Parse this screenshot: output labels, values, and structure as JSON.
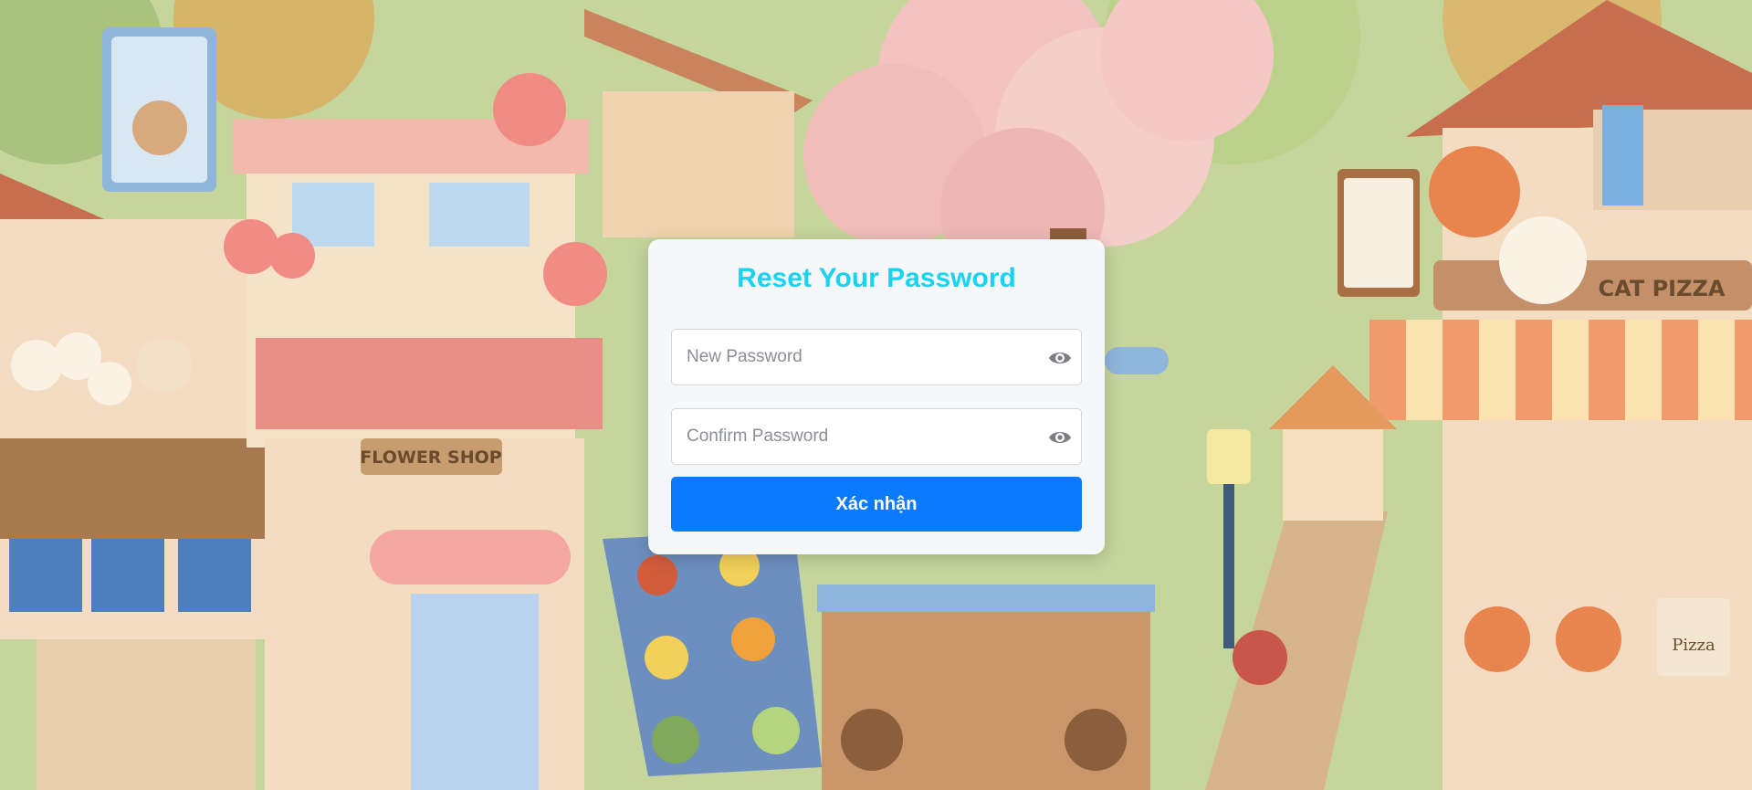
{
  "background": {
    "signs": {
      "flower_shop": "FLOWER SHOP",
      "cat_pizza": "CAT PIZZA",
      "pizza_box": "Pizza"
    }
  },
  "form": {
    "title": "Reset Your Password",
    "new_password_placeholder": "New Password",
    "confirm_password_placeholder": "Confirm Password",
    "submit_label": "Xác nhận",
    "eye_icon_name": "eye-icon",
    "colors": {
      "title": "#19d3f0",
      "button": "#0a7bff",
      "card": "#f6f7f9"
    }
  }
}
